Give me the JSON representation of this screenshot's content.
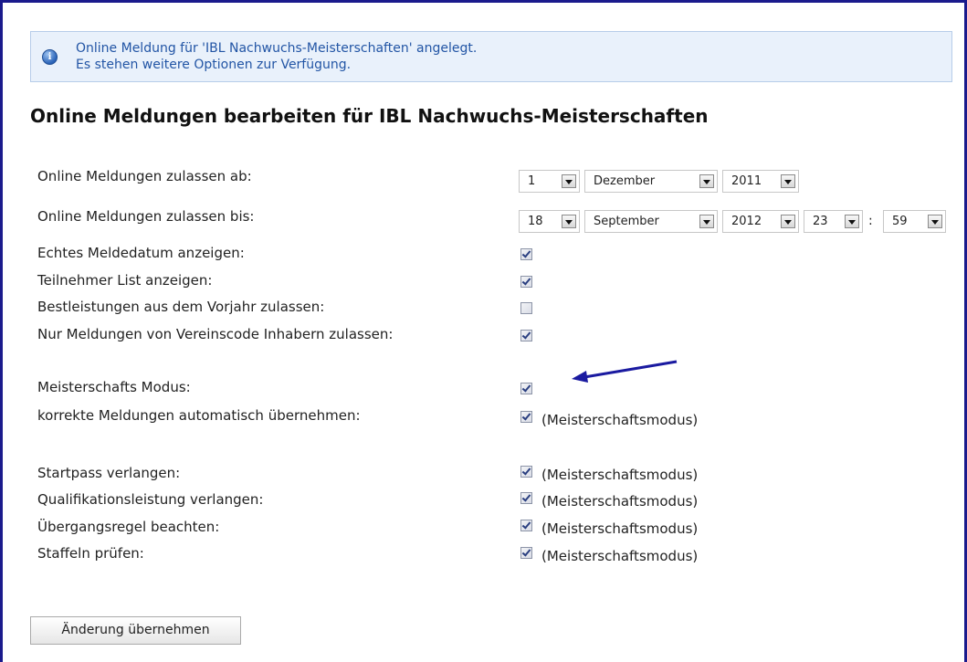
{
  "info": {
    "line1": "Online Meldung für 'IBL Nachwuchs-Meisterschaften' angelegt.",
    "line2": "Es stehen weitere Optionen zur Verfügung.",
    "icon": "info-icon",
    "icon_glyph": "i"
  },
  "title": "Online Meldungen bearbeiten für IBL Nachwuchs-Meisterschaften",
  "dates": {
    "from_label": "Online Meldungen zulassen ab:",
    "from_day": "1",
    "from_month": "Dezember",
    "from_year": "2011",
    "until_label": "Online Meldungen zulassen bis:",
    "until_day": "18",
    "until_month": "September",
    "until_year": "2012",
    "until_hour": "23",
    "time_sep": ":",
    "until_minute": "59"
  },
  "options": [
    {
      "label": "Echtes Meldedatum anzeigen:",
      "checked": true
    },
    {
      "label": "Teilnehmer List anzeigen:",
      "checked": true
    },
    {
      "label": "Bestleistungen aus dem Vorjahr zulassen:",
      "checked": false
    },
    {
      "label": "Nur Meldungen von Vereinscode Inhabern zulassen:",
      "checked": true
    }
  ],
  "championship": [
    {
      "label": "Meisterschafts Modus:",
      "checked": true,
      "note": ""
    },
    {
      "label": "korrekte Meldungen automatisch übernehmen:",
      "checked": true,
      "note": "(Meisterschaftsmodus)"
    }
  ],
  "requirements": [
    {
      "label": "Startpass verlangen:",
      "checked": true,
      "note": "(Meisterschaftsmodus)"
    },
    {
      "label": "Qualifikationsleistung verlangen:",
      "checked": true,
      "note": "(Meisterschaftsmodus)"
    },
    {
      "label": "Übergangsregel beachten:",
      "checked": true,
      "note": "(Meisterschaftsmodus)"
    },
    {
      "label": "Staffeln prüfen:",
      "checked": true,
      "note": "(Meisterschaftsmodus)"
    }
  ],
  "submit_label": "Änderung übernehmen",
  "colors": {
    "frame": "#1a1a8c",
    "info_text": "#2255a5",
    "info_bg": "#e9f1fb",
    "arrow": "#1a1aa0"
  }
}
